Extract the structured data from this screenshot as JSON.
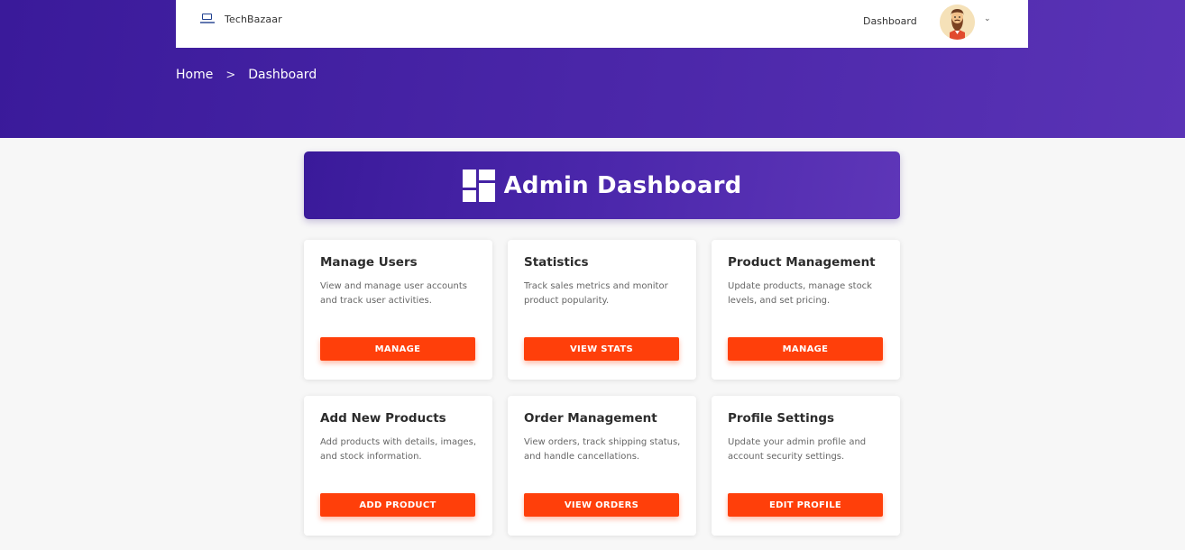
{
  "navbar": {
    "brand": "TechBazaar",
    "dashboard_link": "Dashboard",
    "caret": "⌄"
  },
  "breadcrumb": {
    "home": "Home",
    "separator": ">",
    "current": "Dashboard"
  },
  "banner": {
    "title": "Admin Dashboard",
    "icon": "dashboard-grid-icon"
  },
  "cards": [
    {
      "title": "Manage Users",
      "description": "View and manage user accounts and track user activities.",
      "button": "MANAGE"
    },
    {
      "title": "Statistics",
      "description": "Track sales metrics and monitor product popularity.",
      "button": "VIEW STATS"
    },
    {
      "title": "Product Management",
      "description": "Update products, manage stock levels, and set pricing.",
      "button": "MANAGE"
    },
    {
      "title": "Add New Products",
      "description": "Add products with details, images, and stock information.",
      "button": "ADD PRODUCT"
    },
    {
      "title": "Order Management",
      "description": "View orders, track shipping status, and handle cancellations.",
      "button": "VIEW ORDERS"
    },
    {
      "title": "Profile Settings",
      "description": "Update your admin profile and account security settings.",
      "button": "EDIT PROFILE"
    }
  ],
  "colors": {
    "primary": "#3a1a9a",
    "accent": "#ff3f0a",
    "background": "#f7f7f7"
  }
}
